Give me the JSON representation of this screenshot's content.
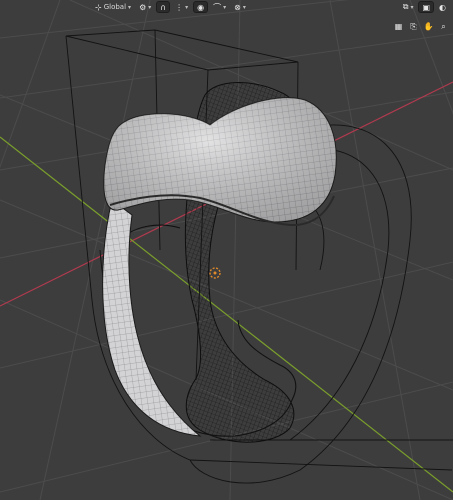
{
  "header": {
    "transform_orientation": "Global"
  },
  "icons": {
    "transform_orientation": "axis-gizmo-icon",
    "pivot": "pivot-point-icon",
    "snap": "magnet-icon",
    "snap_target": "increment-icon",
    "proportional": "proportional-edit-icon",
    "falloff": "falloff-curve-icon",
    "overlays": "overlays-icon",
    "xray": "xray-toggle-icon",
    "shading_solid": "solid-shading-icon",
    "zoom": "zoom-icon",
    "camera": "camera-icon",
    "hand": "hand-pan-icon",
    "grid_view": "grid-view-icon"
  },
  "colors": {
    "viewport_bg": "#3d3d3d",
    "grid_line": "#4b4b4b",
    "axis_x": "#b03a4e",
    "axis_y": "#7a9e2c",
    "mesh_surface": "#cfcfd1",
    "wire": "#141414",
    "origin_dot": "#e08a2a"
  }
}
